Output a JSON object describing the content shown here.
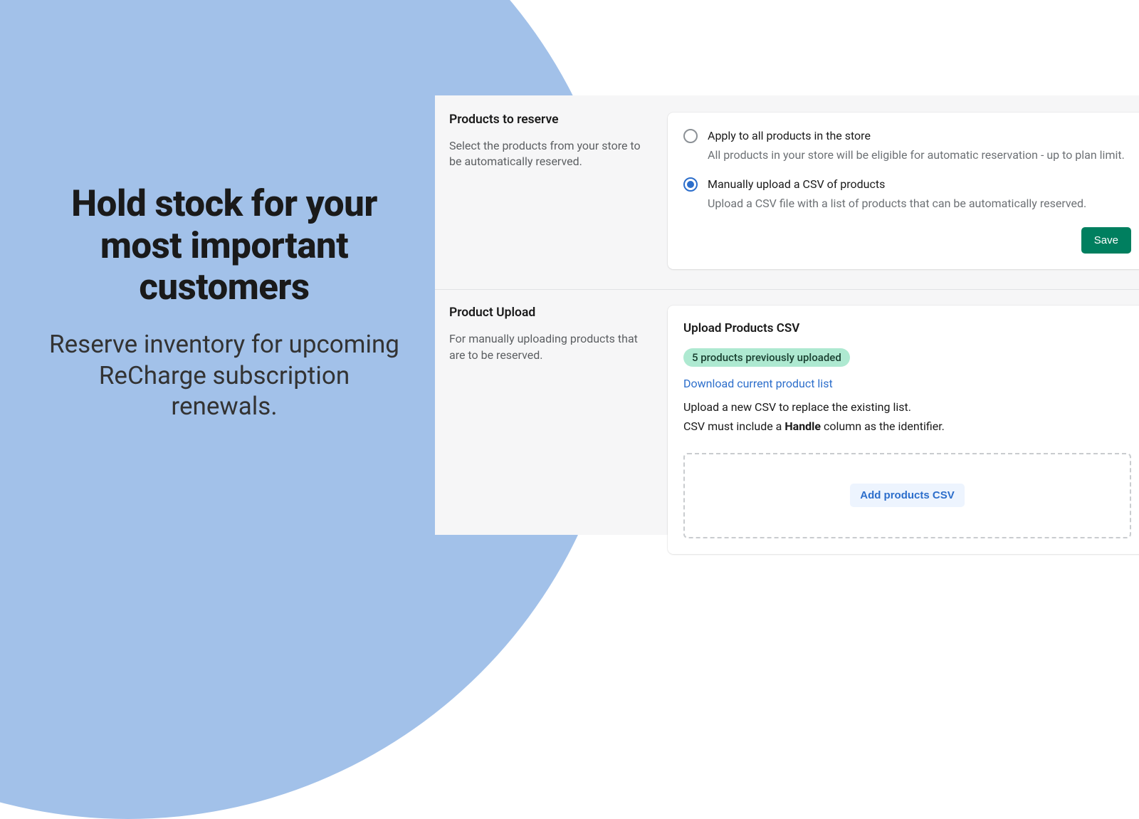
{
  "hero": {
    "title": "Hold stock for your most important customers",
    "subtitle": "Reserve inventory for upcoming ReCharge subscription renewals."
  },
  "sections": {
    "reserve": {
      "title": "Products to reserve",
      "desc": "Select the products from your store to be automatically reserved."
    },
    "upload": {
      "title": "Product Upload",
      "desc": "For manually uploading products that are to be reserved."
    }
  },
  "radios": {
    "all": {
      "label": "Apply to all products in the store",
      "help": "All products in your store will be eligible for automatic reservation - up to plan limit.",
      "selected": false
    },
    "csv": {
      "label": "Manually upload a CSV of products",
      "help": "Upload a CSV file with a list of products that can be automatically reserved.",
      "selected": true
    }
  },
  "buttons": {
    "save": "Save",
    "add_csv": "Add products CSV"
  },
  "upload_card": {
    "title": "Upload Products CSV",
    "badge": "5 products previously uploaded",
    "download_link": "Download current product list",
    "instr1": "Upload a new CSV to replace the existing list.",
    "instr2_pre": "CSV must include a ",
    "instr2_bold": "Handle",
    "instr2_post": " column as the identifier."
  }
}
